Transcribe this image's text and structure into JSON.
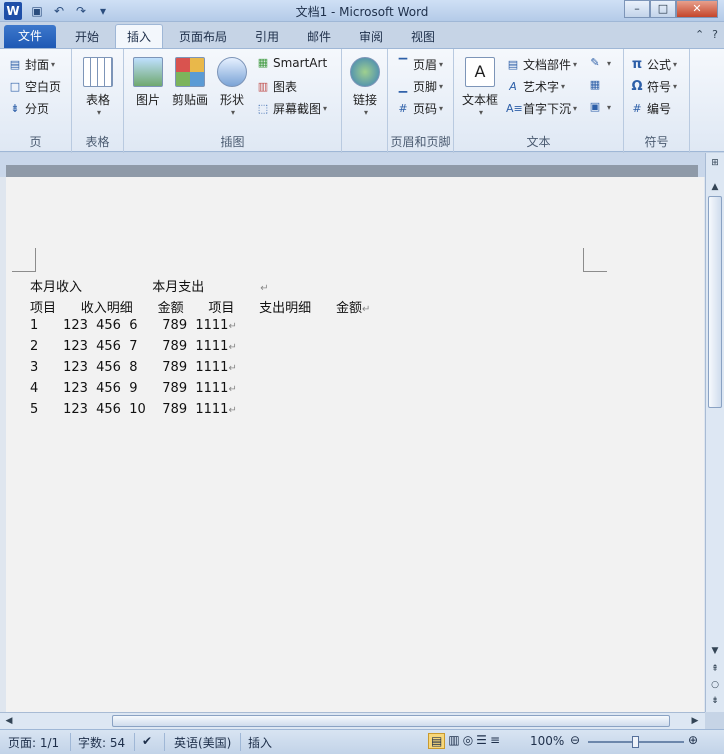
{
  "window": {
    "title": "文档1 - Microsoft Word",
    "logo": "W"
  },
  "tabs": [
    {
      "label": "文件"
    },
    {
      "label": "开始"
    },
    {
      "label": "插入"
    },
    {
      "label": "页面布局"
    },
    {
      "label": "引用"
    },
    {
      "label": "邮件"
    },
    {
      "label": "审阅"
    },
    {
      "label": "视图"
    }
  ],
  "active_tab": "插入",
  "ribbon": {
    "pages": {
      "label": "页",
      "cover": "封面",
      "blank": "空白页",
      "break": "分页"
    },
    "tables": {
      "label": "表格",
      "table": "表格"
    },
    "illustrations": {
      "label": "插图",
      "picture": "图片",
      "clipart": "剪贴画",
      "shapes": "形状",
      "smartart": "SmartArt",
      "chart": "图表",
      "screenshot": "屏幕截图"
    },
    "links": {
      "link": "链接"
    },
    "header_footer": {
      "label": "页眉和页脚",
      "header": "页眉",
      "footer": "页脚",
      "page_number": "页码"
    },
    "text": {
      "label": "文本",
      "textbox": "文本框",
      "quickparts": "文档部件",
      "wordart": "艺术字",
      "dropcap": "首字下沉"
    },
    "symbols": {
      "label": "符号",
      "equation": "公式",
      "symbol": "符号",
      "number": "编号"
    }
  },
  "document": {
    "lines": [
      "本月收入                 本月支出",
      "项目      收入明细      金额      项目      支出明细      金额",
      "1      123  456  6      789  1111",
      "2      123  456  7      789  1111",
      "3      123  456  8      789  1111",
      "4      123  456  9      789  1111",
      "5      123  456  10    789  1111"
    ],
    "paragraph_mark": "↵"
  },
  "status": {
    "page": "页面: 1/1",
    "words": "字数: 54",
    "language": "英语(美国)",
    "mode": "插入",
    "zoom": "100%"
  }
}
